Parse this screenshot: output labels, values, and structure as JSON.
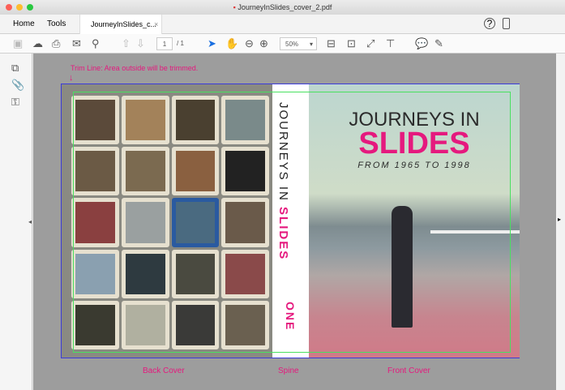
{
  "window": {
    "title": "JourneyInSlides_cover_2.pdf"
  },
  "tabs": {
    "home": "Home",
    "tools": "Tools",
    "doc_tab": "JourneyInSlides_c...",
    "close": "×"
  },
  "toolbar": {
    "page_current": "1",
    "page_total": "/ 1",
    "zoom": "50%"
  },
  "page": {
    "trim_note": "Trim Line: Area outside will be trimmed.",
    "spine_title": "JOURNEYS IN",
    "spine_title_accent": "SLIDES",
    "spine_bottom": "ONE",
    "front_title": "JOURNEYS IN",
    "front_title_accent": "SLIDES",
    "front_subtitle": "FROM 1965 TO 1998",
    "labels": {
      "back": "Back Cover",
      "spine": "Spine",
      "front": "Front Cover"
    }
  },
  "colors": {
    "accent": "#e5197e",
    "trim": "#49e060",
    "bleed": "#3b3bd9"
  }
}
